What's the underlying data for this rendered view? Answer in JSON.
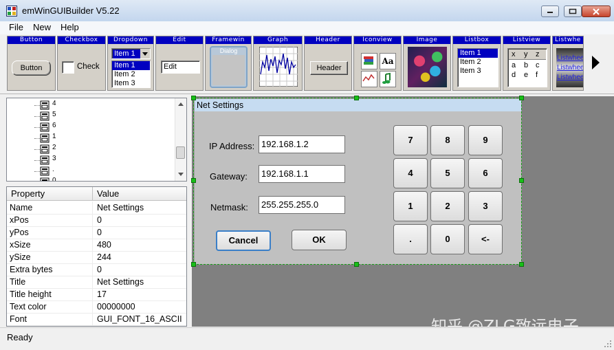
{
  "window": {
    "title": "emWinGUIBuilder V5.22",
    "minimize_icon": "minimize-icon",
    "maximize_icon": "maximize-icon",
    "close_icon": "close-icon"
  },
  "menu": [
    "File",
    "New",
    "Help"
  ],
  "toolbox": {
    "tools": [
      "Button",
      "Checkbox",
      "Dropdown",
      "Edit",
      "Framewin",
      "Graph",
      "Header",
      "Iconview",
      "Image",
      "Listbox",
      "Listview",
      "Listwhe"
    ],
    "button_sample": "Button",
    "checkbox_sample": "Check",
    "dropdown_sample": "Item 1",
    "dropdown_items": [
      "Item 1",
      "Item 2",
      "Item 3"
    ],
    "edit_sample": "Edit",
    "framewin_sample": "Dialog",
    "header_sample": "Header",
    "iconview_text_icon": "Aa",
    "listbox_items": [
      "Item 1",
      "Item 2",
      "Item 3"
    ],
    "listview_cells": [
      "x",
      "y",
      "z",
      "a",
      "b",
      "c",
      "d",
      "e",
      "f"
    ],
    "listwheel_items": [
      "Listwhee",
      "Listwhee",
      "Listwhee"
    ],
    "scroll_right_icon": "triangle-right-icon"
  },
  "tree": {
    "items": [
      "4",
      "5",
      "6",
      "1",
      "2",
      "3",
      ".",
      "0"
    ]
  },
  "properties": {
    "header_property": "Property",
    "header_value": "Value",
    "rows": [
      {
        "name": "Name",
        "value": "Net Settings"
      },
      {
        "name": "xPos",
        "value": "0"
      },
      {
        "name": "yPos",
        "value": "0"
      },
      {
        "name": "xSize",
        "value": "480"
      },
      {
        "name": "ySize",
        "value": "244"
      },
      {
        "name": "Extra bytes",
        "value": "0"
      },
      {
        "name": "Title",
        "value": "Net Settings"
      },
      {
        "name": "Title height",
        "value": "17"
      },
      {
        "name": "Text color",
        "value": "00000000"
      },
      {
        "name": "Font",
        "value": "GUI_FONT_16_ASCII"
      }
    ]
  },
  "dialog": {
    "title": "Net Settings",
    "ip_label": "IP Address:",
    "ip_value": "192.168.1.2",
    "gateway_label": "Gateway:",
    "gateway_value": "192.168.1.1",
    "netmask_label": "Netmask:",
    "netmask_value": "255.255.255.0",
    "cancel": "Cancel",
    "ok": "OK",
    "keys": [
      "7",
      "8",
      "9",
      "4",
      "5",
      "6",
      "1",
      "2",
      "3",
      ".",
      "0",
      "<-"
    ]
  },
  "watermark": "知乎 @ZLG致远电子",
  "status": "Ready"
}
